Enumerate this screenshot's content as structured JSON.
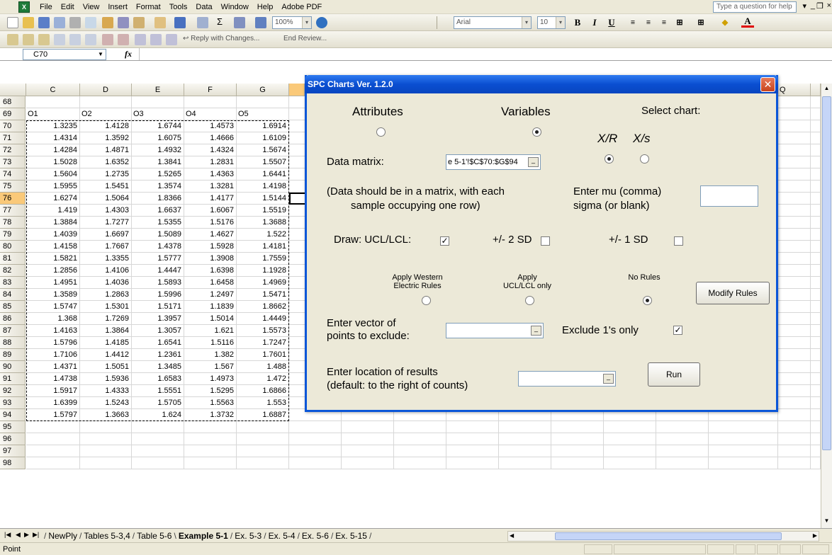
{
  "app": {
    "menu": [
      "File",
      "Edit",
      "View",
      "Insert",
      "Format",
      "Tools",
      "Data",
      "Window",
      "Help",
      "Adobe PDF"
    ],
    "help_placeholder": "Type a question for help"
  },
  "toolbar": {
    "zoom": "100%",
    "font": "Arial",
    "font_size": "10",
    "review_reply": "Reply with Changes...",
    "review_end": "End Review..."
  },
  "formula_bar": {
    "name_box": "C70",
    "fx": "fx"
  },
  "sheet": {
    "columns": [
      "C",
      "D",
      "E",
      "F",
      "G",
      "Q"
    ],
    "header_row": {
      "row": "69",
      "values": [
        "O1",
        "O2",
        "O3",
        "O4",
        "O5"
      ]
    },
    "rows": [
      {
        "row": "68",
        "values": []
      },
      {
        "row": "69",
        "values": []
      },
      {
        "row": "70",
        "values": [
          "1.3235",
          "1.4128",
          "1.6744",
          "1.4573",
          "1.6914"
        ]
      },
      {
        "row": "71",
        "values": [
          "1.4314",
          "1.3592",
          "1.6075",
          "1.4666",
          "1.6109"
        ]
      },
      {
        "row": "72",
        "values": [
          "1.4284",
          "1.4871",
          "1.4932",
          "1.4324",
          "1.5674"
        ]
      },
      {
        "row": "73",
        "values": [
          "1.5028",
          "1.6352",
          "1.3841",
          "1.2831",
          "1.5507"
        ]
      },
      {
        "row": "74",
        "values": [
          "1.5604",
          "1.2735",
          "1.5265",
          "1.4363",
          "1.6441"
        ]
      },
      {
        "row": "75",
        "values": [
          "1.5955",
          "1.5451",
          "1.3574",
          "1.3281",
          "1.4198"
        ]
      },
      {
        "row": "76",
        "values": [
          "1.6274",
          "1.5064",
          "1.8366",
          "1.4177",
          "1.5144"
        ]
      },
      {
        "row": "77",
        "values": [
          "1.419",
          "1.4303",
          "1.6637",
          "1.6067",
          "1.5519"
        ]
      },
      {
        "row": "78",
        "values": [
          "1.3884",
          "1.7277",
          "1.5355",
          "1.5176",
          "1.3688"
        ]
      },
      {
        "row": "79",
        "values": [
          "1.4039",
          "1.6697",
          "1.5089",
          "1.4627",
          "1.522"
        ]
      },
      {
        "row": "80",
        "values": [
          "1.4158",
          "1.7667",
          "1.4378",
          "1.5928",
          "1.4181"
        ]
      },
      {
        "row": "81",
        "values": [
          "1.5821",
          "1.3355",
          "1.5777",
          "1.3908",
          "1.7559"
        ]
      },
      {
        "row": "82",
        "values": [
          "1.2856",
          "1.4106",
          "1.4447",
          "1.6398",
          "1.1928"
        ]
      },
      {
        "row": "83",
        "values": [
          "1.4951",
          "1.4036",
          "1.5893",
          "1.6458",
          "1.4969"
        ]
      },
      {
        "row": "84",
        "values": [
          "1.3589",
          "1.2863",
          "1.5996",
          "1.2497",
          "1.5471"
        ]
      },
      {
        "row": "85",
        "values": [
          "1.5747",
          "1.5301",
          "1.5171",
          "1.1839",
          "1.8662"
        ]
      },
      {
        "row": "86",
        "values": [
          "1.368",
          "1.7269",
          "1.3957",
          "1.5014",
          "1.4449"
        ]
      },
      {
        "row": "87",
        "values": [
          "1.4163",
          "1.3864",
          "1.3057",
          "1.621",
          "1.5573"
        ]
      },
      {
        "row": "88",
        "values": [
          "1.5796",
          "1.4185",
          "1.6541",
          "1.5116",
          "1.7247"
        ]
      },
      {
        "row": "89",
        "values": [
          "1.7106",
          "1.4412",
          "1.2361",
          "1.382",
          "1.7601"
        ]
      },
      {
        "row": "90",
        "values": [
          "1.4371",
          "1.5051",
          "1.3485",
          "1.567",
          "1.488"
        ]
      },
      {
        "row": "91",
        "values": [
          "1.4738",
          "1.5936",
          "1.6583",
          "1.4973",
          "1.472"
        ]
      },
      {
        "row": "92",
        "values": [
          "1.5917",
          "1.4333",
          "1.5551",
          "1.5295",
          "1.6866"
        ]
      },
      {
        "row": "93",
        "values": [
          "1.6399",
          "1.5243",
          "1.5705",
          "1.5563",
          "1.553"
        ]
      },
      {
        "row": "94",
        "values": [
          "1.5797",
          "1.3663",
          "1.624",
          "1.3732",
          "1.6887"
        ]
      },
      {
        "row": "95",
        "values": []
      },
      {
        "row": "96",
        "values": []
      },
      {
        "row": "97",
        "values": []
      },
      {
        "row": "98",
        "values": []
      }
    ],
    "selected_row": "76"
  },
  "tabs": {
    "items": [
      "NewPly",
      "Tables 5-3,4",
      "Table 5-6",
      "Example 5-1",
      "Ex. 5-3",
      "Ex. 5-4",
      "Ex. 5-6",
      "Ex. 5-15"
    ],
    "active": "Example 5-1"
  },
  "status": {
    "mode": "Point"
  },
  "dialog": {
    "title": "SPC Charts Ver. 1.2.0",
    "attributes_label": "Attributes",
    "variables_label": "Variables",
    "select_chart_label": "Select chart:",
    "xr_label": "X/R",
    "xs_label": "X/s",
    "data_matrix_label": "Data matrix:",
    "data_matrix_value": "e 5-1'!$C$70:$G$94",
    "matrix_note": "(Data should be in a matrix, with each",
    "matrix_note2": "sample occupying one row)",
    "mu_label": "Enter mu (comma)",
    "sigma_label": "sigma (or blank)",
    "mu_value": "",
    "draw_ucl_label": "Draw: UCL/LCL:",
    "two_sd_label": "+/- 2 SD",
    "one_sd_label": "+/- 1 SD",
    "western_label": "Apply Western",
    "western_label2": "Electric Rules",
    "ucl_only_label": "Apply",
    "ucl_only_label2": "UCL/LCL only",
    "no_rules_label": "No Rules",
    "modify_rules_button": "Modify Rules",
    "exclude_label": "Enter vector of",
    "exclude_label2": "points to exclude:",
    "exclude_value": "",
    "exclude_ones_label": "Exclude 1's only",
    "results_label": "Enter location of results",
    "results_label2": "(default: to the right of counts)",
    "results_value": "",
    "run_button": "Run",
    "state": {
      "attributes": false,
      "variables": true,
      "xr": true,
      "xs": false,
      "ucl_lcl": true,
      "two_sd": false,
      "one_sd": false,
      "western": false,
      "ucl_only": false,
      "no_rules": true,
      "exclude_ones": true
    }
  }
}
